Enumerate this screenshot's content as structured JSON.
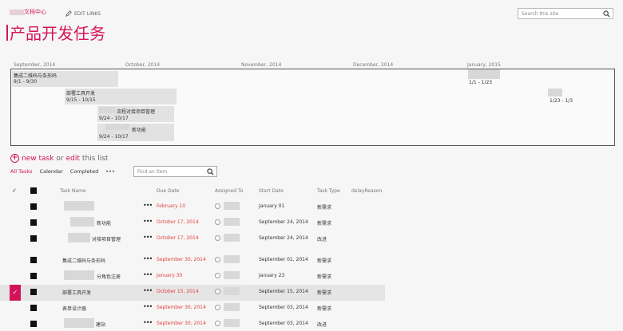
{
  "header": {
    "site_name": "文档中心",
    "edit_links": "EDIT LINKS",
    "search_placeholder": "Search this site",
    "page_title": "产品开发任务"
  },
  "timeline": {
    "months": [
      "September, 2014",
      "October, 2014",
      "November, 2014",
      "December, 2014",
      "January, 2015"
    ],
    "items": [
      {
        "title": "集成二维码与条形码",
        "dates": "9/1 - 9/30"
      },
      {
        "title": "部署工具开发",
        "dates": "9/15 - 10/15"
      },
      {
        "title": "流程对接项目管理",
        "dates": "9/24 - 10/17"
      },
      {
        "title": "新功能",
        "dates": "9/24 - 10/17"
      },
      {
        "title": "",
        "dates": "1/1 - 1/23"
      },
      {
        "title": "",
        "dates": "1/23 - 1/3"
      }
    ]
  },
  "commands": {
    "new_task": "new task",
    "or": "or",
    "edit": "edit",
    "this_list": "this list"
  },
  "views": {
    "all_tasks": "All Tasks",
    "calendar": "Calendar",
    "completed": "Completed",
    "more": "•••",
    "find_placeholder": "Find an item"
  },
  "table": {
    "columns": [
      "Task Name",
      "Due Date",
      "Assigned To",
      "Start Date",
      "Task Type",
      "delayReason"
    ],
    "rows": [
      {
        "name": "",
        "due": "February 10",
        "start": "January 01",
        "type": "新需求",
        "overdue": true
      },
      {
        "name": "新功能",
        "due": "October 17, 2014",
        "start": "September 24, 2014",
        "type": "新需求",
        "overdue": true
      },
      {
        "name": "对接项目管理",
        "due": "October 17, 2014",
        "start": "September 24, 2014",
        "type": "改进",
        "overdue": true
      },
      {
        "name": "集成二维码与条形码",
        "due": "September 30, 2014",
        "start": "September 01, 2014",
        "type": "新需求",
        "overdue": true
      },
      {
        "name": "分角色注册",
        "due": "January 30",
        "start": "January 23",
        "type": "新需求",
        "overdue": true
      },
      {
        "name": "部署工具开发",
        "due": "October 15, 2014",
        "start": "September 15, 2014",
        "type": "新需求",
        "overdue": true,
        "selected": true
      },
      {
        "name": "表单设计器",
        "due": "September 30, 2014",
        "start": "September 03, 2014",
        "type": "新需求",
        "overdue": true
      },
      {
        "name": "建站",
        "due": "September 30, 2014",
        "start": "September 03, 2014",
        "type": "改进",
        "overdue": true
      }
    ]
  },
  "colors": {
    "accent": "#d4145a",
    "overdue": "#e2403a"
  }
}
